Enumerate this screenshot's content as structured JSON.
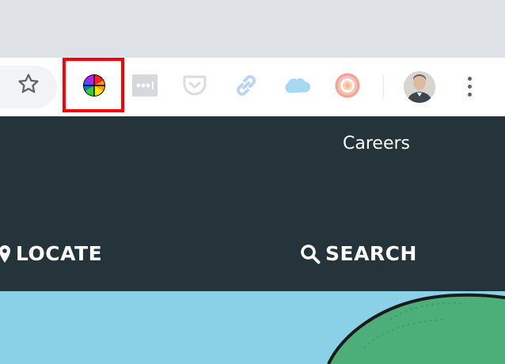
{
  "browser": {
    "extensions": [
      {
        "icon": "color-wheel-icon",
        "highlighted": true
      },
      {
        "icon": "password-dots-icon"
      },
      {
        "icon": "pocket-icon"
      },
      {
        "icon": "link-icon"
      },
      {
        "icon": "salesforce-cloud-icon"
      },
      {
        "icon": "rgb-ring-icon"
      }
    ],
    "highlight_color": "#ff0000"
  },
  "site": {
    "careers_label": "Careers",
    "locate_label": "LOCATE",
    "search_label": "SEARCH",
    "nav_bg": "#24343a",
    "hero_bg": "#8ad0e6",
    "globe_color": "#4caf7a"
  }
}
